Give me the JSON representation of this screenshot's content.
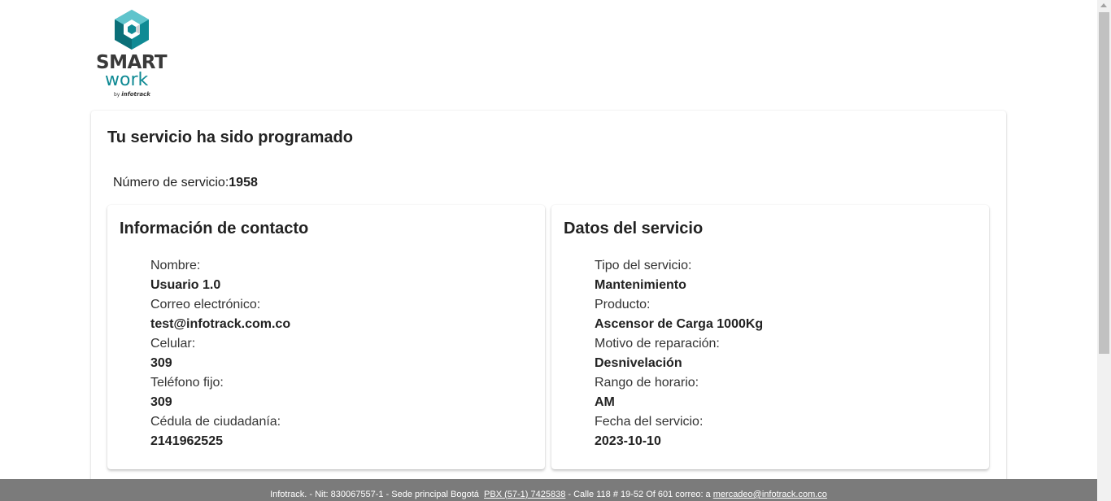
{
  "brand": {
    "line1": "SMART",
    "line2": "work",
    "by_prefix": "by",
    "by_name": "infotrack",
    "colors": {
      "dark": "#3a3a3a",
      "teal": "#0f8a94"
    }
  },
  "main": {
    "title": "Tu servicio ha sido programado",
    "service_number_label": "Número de servicio:",
    "service_number_value": "1958"
  },
  "contact": {
    "title": "Información de contacto",
    "fields": [
      {
        "label": "Nombre:",
        "value": "Usuario 1.0"
      },
      {
        "label": "Correo electrónico:",
        "value": "test@infotrack.com.co"
      },
      {
        "label": "Celular:",
        "value": "309"
      },
      {
        "label": "Teléfono fijo:",
        "value": "309"
      },
      {
        "label": "Cédula de ciudadanía:",
        "value": "2141962525"
      }
    ]
  },
  "service": {
    "title": "Datos del servicio",
    "fields": [
      {
        "label": "Tipo del servicio:",
        "value": "Mantenimiento"
      },
      {
        "label": "Producto:",
        "value": "Ascensor de Carga 1000Kg"
      },
      {
        "label": "Motivo de reparación:",
        "value": "Desnivelación"
      },
      {
        "label": "Rango de horario:",
        "value": "AM"
      },
      {
        "label": "Fecha del servicio:",
        "value": "2023-10-10"
      }
    ]
  },
  "footer": {
    "part1": "Infotrack. - Nit: 830067557-1 - Sede principal Bogotá",
    "phone_link": "PBX (57-1) 7425838",
    "part2": "- Calle 118 # 19-52 Of 601   correo: a",
    "email_link": "mercadeo@infotrack.com.co",
    "background": "#7b7b7b"
  }
}
